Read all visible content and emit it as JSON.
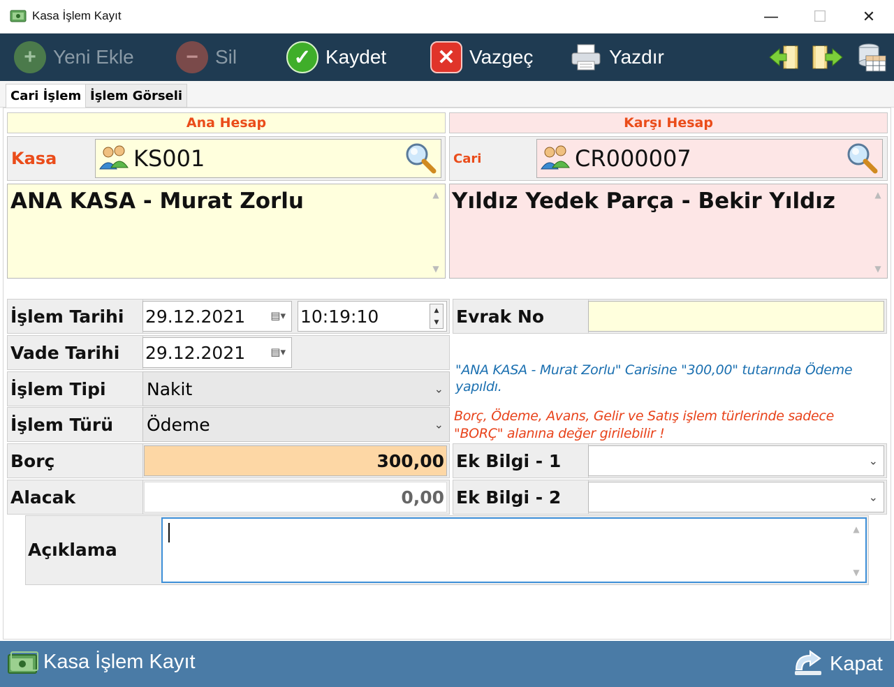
{
  "window": {
    "title": "Kasa İşlem Kayıt",
    "minimize": "—",
    "maximize": "☐",
    "close": "✕"
  },
  "toolbar": {
    "new_label": "Yeni Ekle",
    "delete_label": "Sil",
    "save_label": "Kaydet",
    "cancel_label": "Vazgeç",
    "print_label": "Yazdır",
    "icons": [
      "plus-circle-icon",
      "minus-circle-icon",
      "check-icon",
      "x-circle-icon",
      "printer-icon",
      "arrow-left-icon",
      "arrow-right-icon",
      "table-grid-icon"
    ]
  },
  "tabs": [
    {
      "label": "Cari İşlem",
      "active": true
    },
    {
      "label": "İşlem Görseli",
      "active": false
    }
  ],
  "ana_hesap": {
    "header": "Ana Hesap",
    "type_label": "Kasa",
    "code": "KS001",
    "name": "ANA KASA - Murat Zorlu",
    "bg": "#ffffdd"
  },
  "karsi_hesap": {
    "header": "Karşı Hesap",
    "type_label": "Cari",
    "code": "CR000007",
    "name": "Yıldız Yedek Parça - Bekir Yıldız",
    "bg": "#fde6e6"
  },
  "form": {
    "islem_tarihi_label": "İşlem Tarihi",
    "islem_tarihi": "29.12.2021",
    "islem_saati": "10:19:10",
    "vade_tarihi_label": "Vade Tarihi",
    "vade_tarihi": "29.12.2021",
    "islem_tipi_label": "İşlem Tipi",
    "islem_tipi": "Nakit",
    "islem_turu_label": "İşlem Türü",
    "islem_turu": "Ödeme",
    "borc_label": "Borç",
    "borc": "300,00",
    "alacak_label": "Alacak",
    "alacak": "0,00",
    "evrak_no_label": "Evrak No",
    "evrak_no": "",
    "ek_bilgi1_label": "Ek Bilgi - 1",
    "ek_bilgi1": "",
    "ek_bilgi2_label": "Ek Bilgi - 2",
    "ek_bilgi2": "",
    "aciklama_label": "Açıklama",
    "aciklama": ""
  },
  "messages": {
    "info": "\"ANA KASA - Murat Zorlu\" Carisine \"300,00\" tutarında Ödeme yapıldı.",
    "warning": "Borç, Ödeme, Avans, Gelir ve Satış işlem türlerinde sadece \"BORÇ\" alanına değer girilebilir !",
    "info_color": "#1a6fb0",
    "warning_color": "#e8421a"
  },
  "footer": {
    "title": "Kasa İşlem Kayıt",
    "close_label": "Kapat"
  },
  "colors": {
    "toolbar_bg": "#1f3b52",
    "footer_bg": "#4a7ba6",
    "borc_bg": "#fdd7a5",
    "evrak_bg": "#ffffdd"
  }
}
